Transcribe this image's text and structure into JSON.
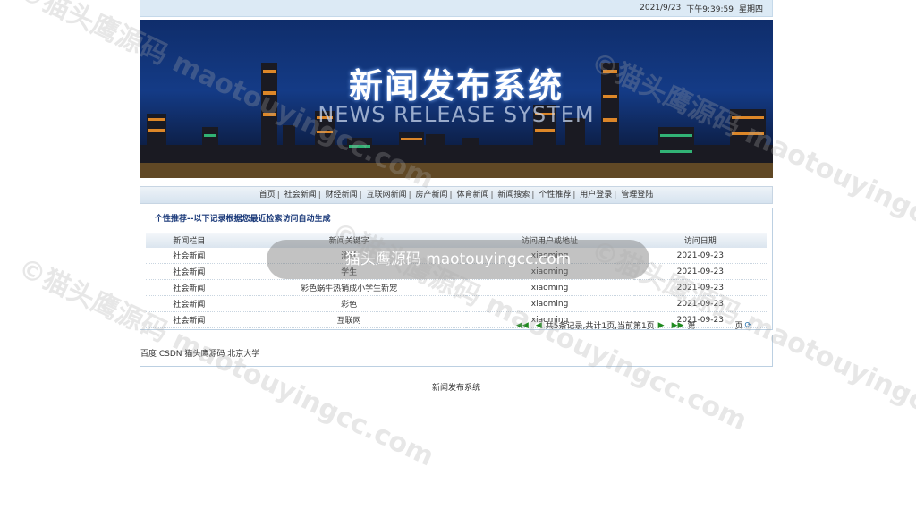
{
  "header": {
    "date": "2021/9/23",
    "time": "下午9:39:59",
    "weekday": "星期四"
  },
  "banner": {
    "title": "新闻发布系统",
    "subtitle": "NEWS RELEASE SYSTEM"
  },
  "nav": {
    "items": [
      "首页",
      "社会新闻",
      "财经新闻",
      "互联网新闻",
      "房产新闻",
      "体育新闻",
      "新闻搜索",
      "个性推荐",
      "用户登录",
      "管理登陆"
    ]
  },
  "panel": {
    "title": "个性推荐--以下记录根据您最近检索访问自动生成",
    "columns": [
      "新闻栏目",
      "新闻关键字",
      "访问用户或地址",
      "访问日期"
    ],
    "rows": [
      [
        "社会新闻",
        "测试",
        "xiaoming",
        "2021-09-23"
      ],
      [
        "社会新闻",
        "学生",
        "xiaoming",
        "2021-09-23"
      ],
      [
        "社会新闻",
        "彩色蜗牛热销成小学生新宠",
        "xiaoming",
        "2021-09-23"
      ],
      [
        "社会新闻",
        "彩色",
        "xiaoming",
        "2021-09-23"
      ],
      [
        "社会新闻",
        "互联网",
        "xiaoming",
        "2021-09-23"
      ]
    ],
    "pager": {
      "summary": "共5条记录,共计1页,当前第1页",
      "goto_prefix": "第",
      "goto_suffix": "页"
    }
  },
  "links": {
    "text": "百度 CSDN 猫头鹰源码 北京大学"
  },
  "footer": {
    "text": "新闻发布系统"
  },
  "overlay": {
    "toast": "猫头鹰源码 maotouyingcc.com",
    "watermark": "©猫头鹰源码 maotouyingcc.com"
  }
}
